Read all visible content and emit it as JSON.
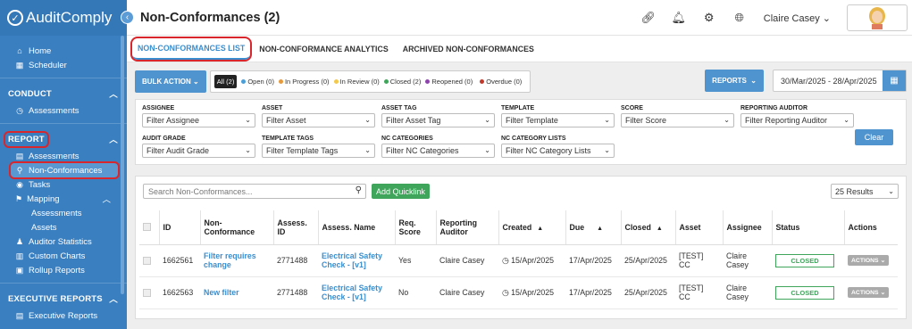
{
  "app": {
    "name": "AuditComply"
  },
  "sidebar": {
    "top_items": [
      {
        "label": "Home"
      },
      {
        "label": "Scheduler"
      }
    ],
    "conduct": {
      "title": "CONDUCT",
      "items": [
        {
          "label": "Assessments"
        }
      ]
    },
    "report": {
      "title": "REPORT",
      "items": [
        {
          "label": "Assessments"
        },
        {
          "label": "Non-Conformances"
        },
        {
          "label": "Tasks"
        },
        {
          "label": "Mapping"
        }
      ],
      "mapping_sub": [
        {
          "label": "Assessments"
        },
        {
          "label": "Assets"
        }
      ],
      "more_items": [
        {
          "label": "Auditor Statistics"
        },
        {
          "label": "Custom Charts"
        },
        {
          "label": "Rollup Reports"
        }
      ]
    },
    "executive": {
      "title": "EXECUTIVE REPORTS",
      "items": [
        {
          "label": "Executive Reports"
        }
      ]
    }
  },
  "header": {
    "title": "Non-Conformances (2)",
    "user": "Claire Casey"
  },
  "tabs": [
    {
      "label": "NON-CONFORMANCES LIST"
    },
    {
      "label": "NON-CONFORMANCE ANALYTICS"
    },
    {
      "label": "ARCHIVED NON-CONFORMANCES"
    }
  ],
  "toolbar": {
    "bulk_action": "BULK ACTION",
    "status_filters": [
      {
        "label": "All (2)",
        "color": ""
      },
      {
        "label": "Open (0)",
        "color": "#4a9fd8"
      },
      {
        "label": "In Progress (0)",
        "color": "#e69a3c"
      },
      {
        "label": "In Review (0)",
        "color": "#f2c94c"
      },
      {
        "label": "Closed (2)",
        "color": "#3fa55b"
      },
      {
        "label": "Reopened (0)",
        "color": "#8e44ad"
      },
      {
        "label": "Overdue (0)",
        "color": "#c0392b"
      }
    ],
    "reports": "REPORTS",
    "date_range": "30/Mar/2025 - 28/Apr/2025"
  },
  "filters": {
    "assignee": {
      "label": "ASSIGNEE",
      "value": "Filter Assignee"
    },
    "asset": {
      "label": "ASSET",
      "value": "Filter Asset"
    },
    "asset_tag": {
      "label": "ASSET TAG",
      "value": "Filter Asset Tag"
    },
    "template": {
      "label": "TEMPLATE",
      "value": "Filter Template"
    },
    "score": {
      "label": "SCORE",
      "value": "Filter Score"
    },
    "reporting_auditor": {
      "label": "REPORTING AUDITOR",
      "value": "Filter Reporting Auditor"
    },
    "audit_grade": {
      "label": "AUDIT GRADE",
      "value": "Filter Audit Grade"
    },
    "template_tags": {
      "label": "TEMPLATE TAGS",
      "value": "Filter Template Tags"
    },
    "nc_categories": {
      "label": "NC CATEGORIES",
      "value": "Filter NC Categories"
    },
    "nc_category_lists": {
      "label": "NC CATEGORY LISTS",
      "value": "Filter NC Category Lists"
    },
    "clear": "Clear"
  },
  "table": {
    "search_placeholder": "Search Non-Conformances...",
    "add_quicklink": "Add Quicklink",
    "results": "25 Results",
    "columns": {
      "id": "ID",
      "nc_line1": "Non-",
      "nc_line2": "Conformance",
      "aid_line1": "Assess.",
      "aid_line2": "ID",
      "aname": "Assess. Name",
      "score_line1": "Req.",
      "score_line2": "Score",
      "auditor_line1": "Reporting",
      "auditor_line2": "Auditor",
      "created": "Created",
      "due": "Due",
      "closed": "Closed",
      "asset": "Asset",
      "assignee": "Assignee",
      "status": "Status",
      "actions": "Actions"
    },
    "rows": [
      {
        "id": "1662561",
        "nc_line1": "Filter requires",
        "nc_line2": "change",
        "aid": "2771488",
        "aname_line1": "Electrical Safety",
        "aname_line2": "Check - [v1]",
        "score": "Yes",
        "auditor": "Claire Casey",
        "created": "15/Apr/2025",
        "due": "17/Apr/2025",
        "closed": "25/Apr/2025",
        "asset_line1": "[TEST]",
        "asset_line2": "CC",
        "assignee_line1": "Claire",
        "assignee_line2": "Casey",
        "status": "CLOSED",
        "actions": "ACTIONS"
      },
      {
        "id": "1662563",
        "nc_line1": "New filter",
        "nc_line2": "",
        "aid": "2771488",
        "aname_line1": "Electrical Safety",
        "aname_line2": "Check - [v1]",
        "score": "No",
        "auditor": "Claire Casey",
        "created": "15/Apr/2025",
        "due": "17/Apr/2025",
        "closed": "25/Apr/2025",
        "asset_line1": "[TEST]",
        "asset_line2": "CC",
        "assignee_line1": "Claire",
        "assignee_line2": "Casey",
        "status": "CLOSED",
        "actions": "ACTIONS"
      }
    ]
  }
}
